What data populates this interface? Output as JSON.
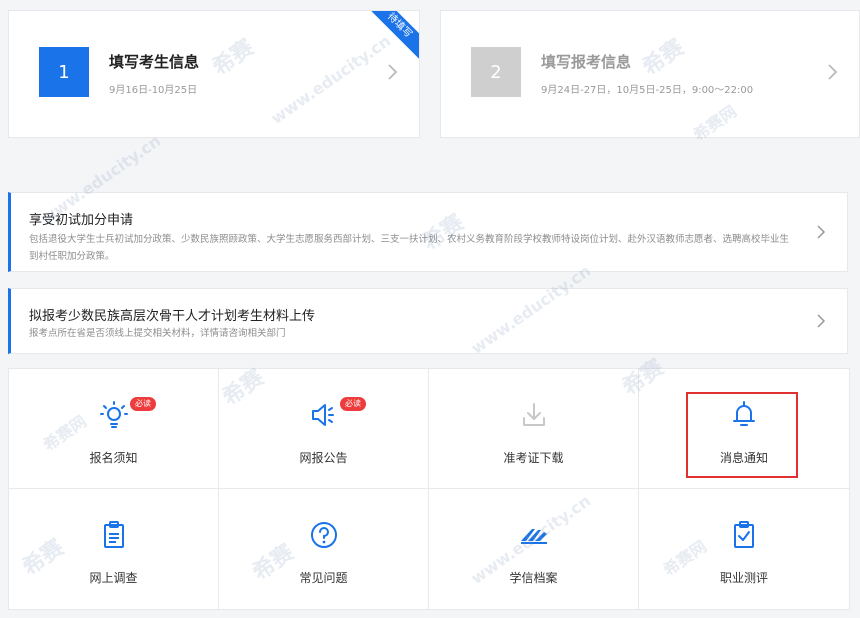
{
  "steps": [
    {
      "number": "1",
      "title": "填写考生信息",
      "date": "9月16日-10月25日",
      "ribbon": "待填写"
    },
    {
      "number": "2",
      "title": "填写报考信息",
      "date": "9月24日-27日，10月5日-25日，9:00～22:00"
    }
  ],
  "notices": [
    {
      "title": "享受初试加分申请",
      "desc": "包括退役大学生士兵初试加分政策、少数民族照顾政策、大学生志愿服务西部计划、三支一扶计划、农村义务教育阶段学校教师特设岗位计划、赴外汉语教师志愿者、选聘高校毕业生到村任职加分政策。"
    },
    {
      "title": "拟报考少数民族高层次骨干人才计划考生材料上传",
      "desc": "报考点所在省是否须线上提交相关材料，详情请咨询相关部门"
    }
  ],
  "grid": [
    {
      "label": "报名须知",
      "icon": "lightbulb-icon",
      "badge": "必读"
    },
    {
      "label": "网报公告",
      "icon": "megaphone-icon",
      "badge": "必读"
    },
    {
      "label": "准考证下载",
      "icon": "download-icon"
    },
    {
      "label": "消息通知",
      "icon": "bell-icon"
    },
    {
      "label": "网上调查",
      "icon": "clipboard-icon"
    },
    {
      "label": "常见问题",
      "icon": "question-circle-icon"
    },
    {
      "label": "学信档案",
      "icon": "xuexin-logo-icon"
    },
    {
      "label": "职业测评",
      "icon": "clipboard-check-icon"
    }
  ],
  "watermark": {
    "brand": "希赛",
    "domain": "www.educity.cn",
    "site": "希赛网"
  },
  "colors": {
    "accent": "#1a73e8",
    "badge": "#ee3b3b",
    "highlight": "#e03030"
  }
}
